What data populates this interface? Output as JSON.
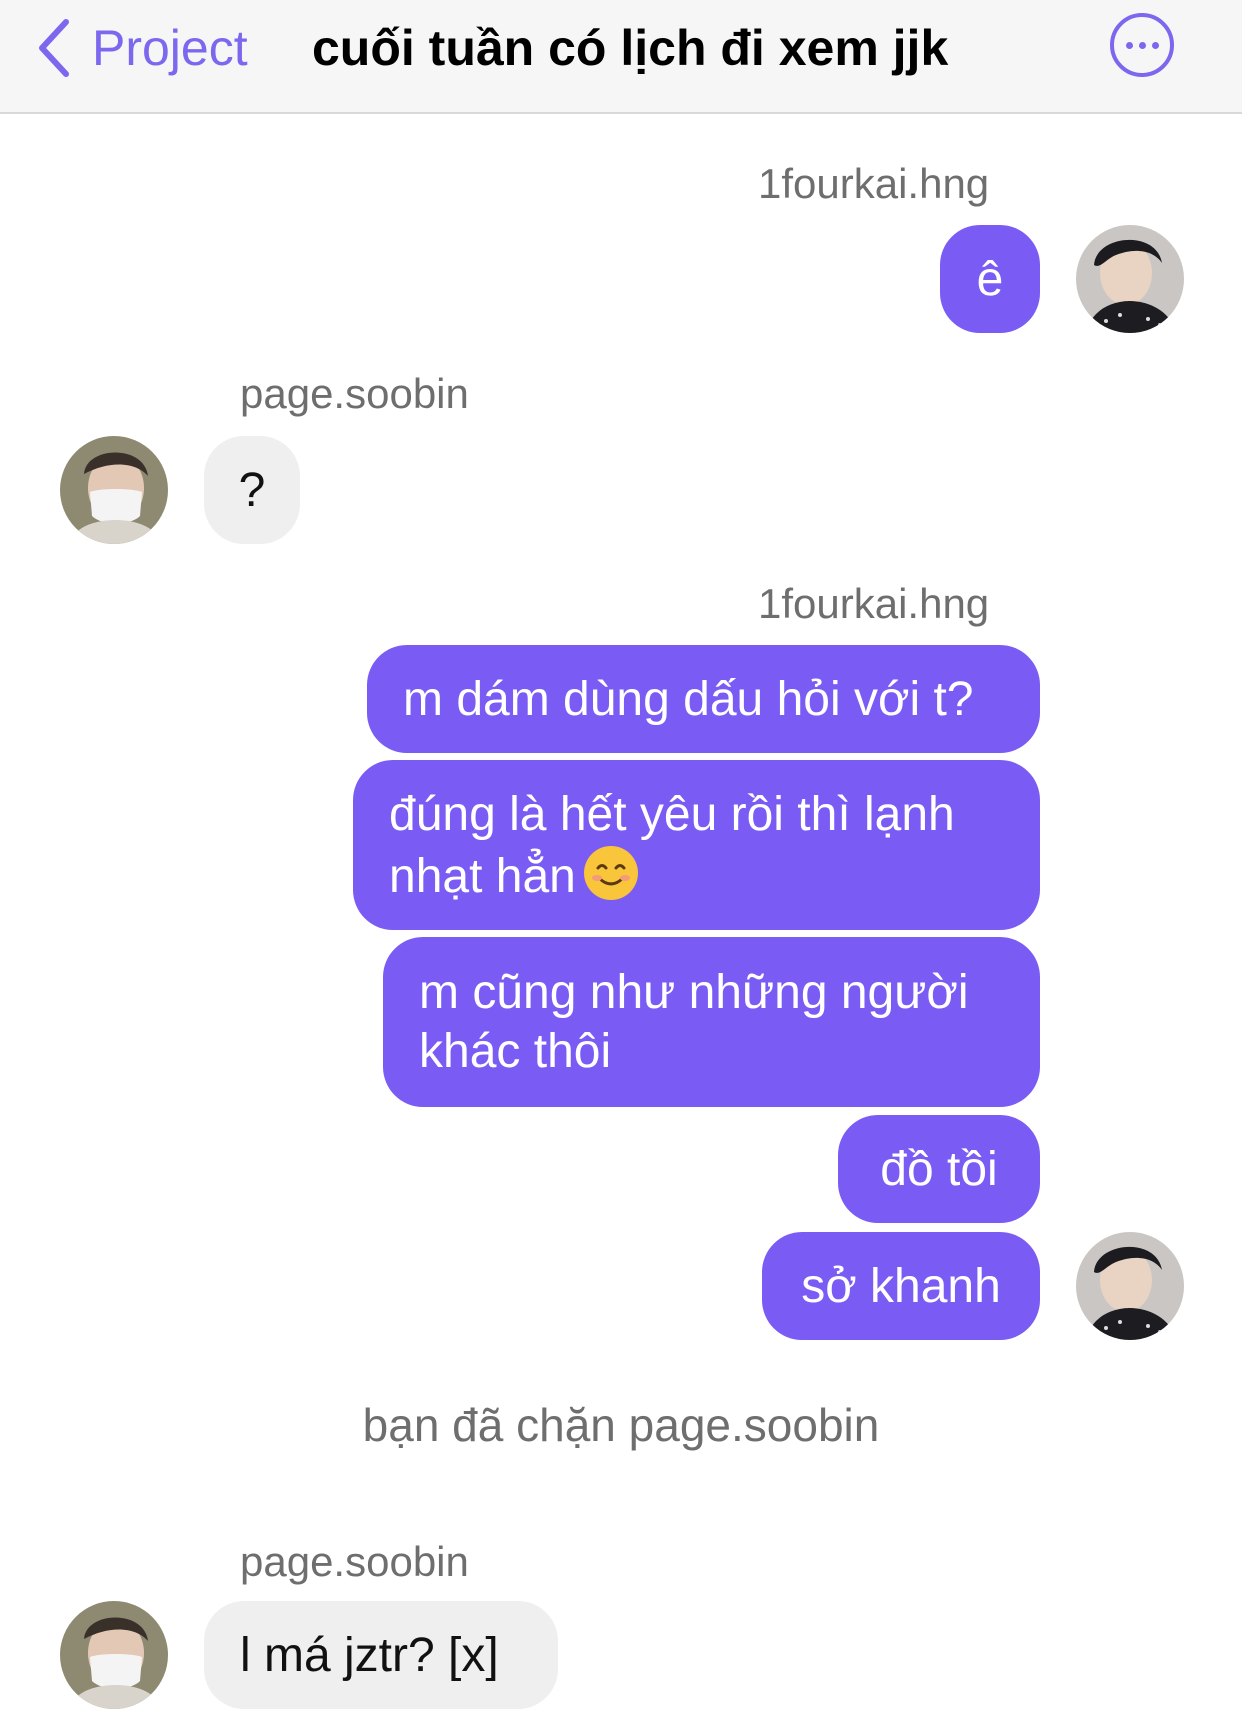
{
  "header": {
    "back_label": "Project",
    "title": "cuối tuần có lịch đi xem jjk",
    "icons": {
      "back": "chevron-left-icon",
      "more": "more-options-icon"
    }
  },
  "colors": {
    "accent": "#7b68ee",
    "outgoing_bubble": "#7a5cf5",
    "incoming_bubble": "#efefef"
  },
  "messages": [
    {
      "sender": "1fourkai.hng",
      "direction": "out",
      "lines": [
        "ê"
      ]
    },
    {
      "sender": "page.soobin",
      "direction": "in",
      "lines": [
        "?"
      ]
    },
    {
      "sender": "1fourkai.hng",
      "direction": "out",
      "lines": [
        "m dám dùng dấu hỏi với t?",
        "đúng là hết yêu rồi thì lạnh nhạt hẳn",
        "m cũng như những người khác thôi",
        "đồ tồi",
        "sở khanh"
      ],
      "emoji_after_line_2": "smiling-face-emoji"
    },
    {
      "system": "bạn đã chặn page.soobin"
    },
    {
      "sender": "page.soobin",
      "direction": "in",
      "lines": [
        "l má jztr? [x]"
      ]
    }
  ]
}
